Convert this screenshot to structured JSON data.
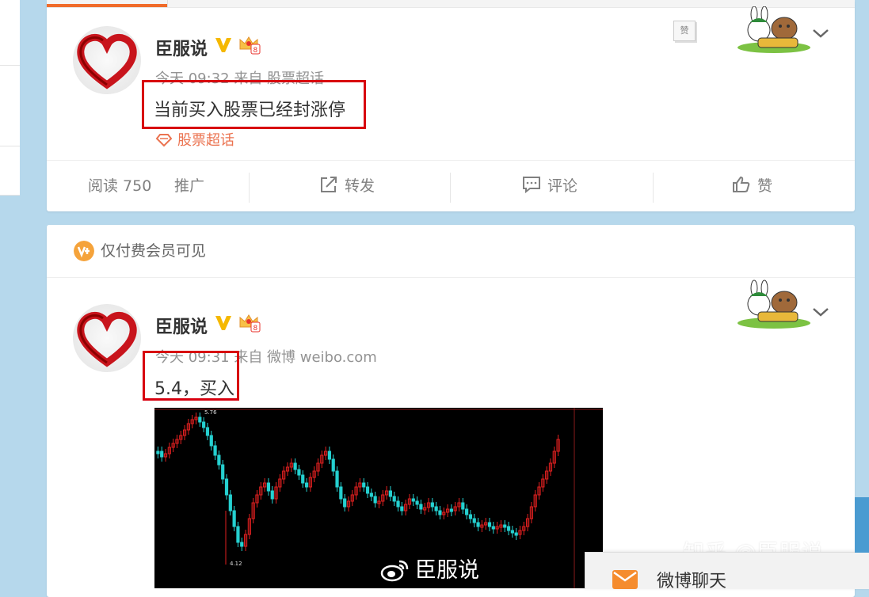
{
  "post1": {
    "username": "臣服说",
    "meta": "今天 09:32 来自 股票超话",
    "text": "当前买入股票已经封涨停",
    "topic": "股票超话",
    "like_badge": "赞",
    "actions": {
      "read_label": "阅读 750",
      "promote": "推广",
      "repost": "转发",
      "comment": "评论",
      "like": "赞"
    }
  },
  "post2": {
    "member_notice": "仅付费会员可见",
    "username": "臣服说",
    "meta": "今天 09:31 来自 微博 weibo.com",
    "text": "5.4，买入"
  },
  "chart_data": {
    "type": "candlestick",
    "title": "",
    "annotations": [
      "5.76",
      "4.12"
    ],
    "colors": {
      "up": "#e02020",
      "down": "#25d0d0"
    }
  },
  "watermarks": {
    "weibo": "臣服说",
    "zhihu": "知乎 @臣服说"
  },
  "chat": {
    "label": "微博聊天"
  },
  "colors": {
    "accent_orange": "#eb7350",
    "highlight_red": "#d8000f",
    "verified_gold": "#f5b800"
  }
}
